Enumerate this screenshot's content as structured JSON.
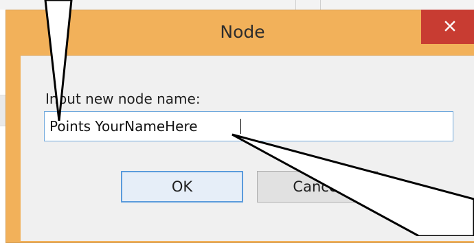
{
  "dialog": {
    "title": "Node",
    "prompt_label": "Input new node name:",
    "input_value": "Points YourNameHere",
    "ok_label": "OK",
    "cancel_label": "Cancel",
    "close_glyph": "✕"
  },
  "colors": {
    "frame": "#f2b15a",
    "close_button": "#c83c32",
    "client": "#f0f0f0",
    "focus_border": "#5a9bdc"
  },
  "icons": [
    "close-icon"
  ]
}
